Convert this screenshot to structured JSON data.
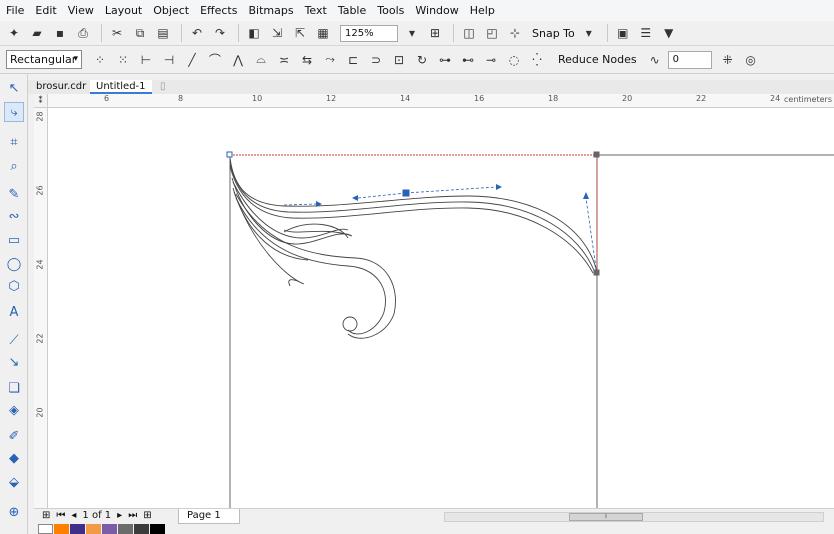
{
  "menu": [
    "File",
    "Edit",
    "View",
    "Layout",
    "Object",
    "Effects",
    "Bitmaps",
    "Text",
    "Table",
    "Tools",
    "Window",
    "Help"
  ],
  "toolbar": {
    "zoom": "125%",
    "snap_to": "Snap To"
  },
  "property_bar": {
    "mode": "Rectangular",
    "reduce_nodes": "Reduce Nodes",
    "curve_smoothness": "0"
  },
  "doc_tabs": [
    "brosur.cdr",
    "Untitled-1"
  ],
  "ruler": {
    "h_ticks": [
      "6",
      "8",
      "10",
      "12",
      "14",
      "16",
      "18",
      "20",
      "22",
      "24"
    ],
    "v_ticks": [
      "28",
      "26",
      "24",
      "22",
      "20"
    ],
    "unit": "centimeters"
  },
  "page_nav": {
    "count": "1 of 1",
    "page_tab": "Page 1"
  },
  "palette": [
    "#ffffff",
    "#ff7f00",
    "#3f2e8a",
    "#f29b46",
    "#7a5ca8",
    "#6b6b6b",
    "#3c3c3c",
    "#000000"
  ]
}
